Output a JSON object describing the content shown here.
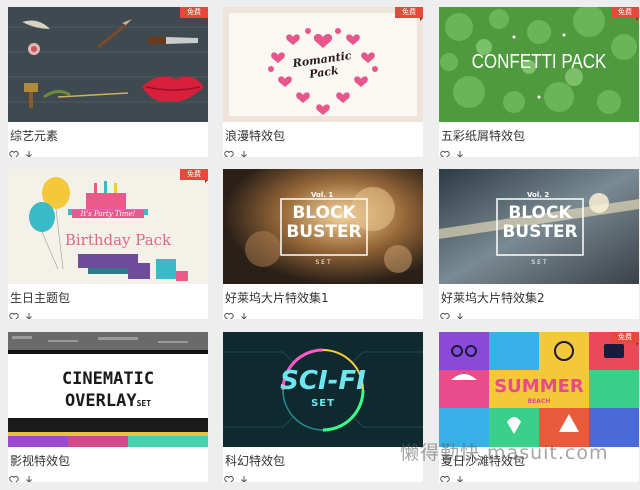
{
  "free_badge": "免费",
  "icons": {
    "favorite": "heart-icon",
    "download": "download-icon"
  },
  "cards": [
    {
      "title": "综艺元素",
      "free": true
    },
    {
      "title": "浪漫特效包",
      "free": true,
      "thumb_text": "Romantic Pack"
    },
    {
      "title": "五彩纸屑特效包",
      "free": true,
      "thumb_text": "CONFETTI PACK"
    },
    {
      "title": "生日主题包",
      "free": true,
      "thumb_text": "Birthday Pack",
      "thumb_sub": "It's Party Time!"
    },
    {
      "title": "好莱坞大片特效集1",
      "free": false,
      "thumb_vol": "Vol. 1",
      "thumb_line1": "BLOCK",
      "thumb_line2": "BUSTER",
      "thumb_set": "SET"
    },
    {
      "title": "好莱坞大片特效集2",
      "free": false,
      "thumb_vol": "Vol. 2",
      "thumb_line1": "BLOCK",
      "thumb_line2": "BUSTER",
      "thumb_set": "SET"
    },
    {
      "title": "影视特效包",
      "free": false,
      "thumb_line1": "CINEMATIC",
      "thumb_line2": "OVERLAY",
      "thumb_set": "SET"
    },
    {
      "title": "科幻特效包",
      "free": false,
      "thumb_line1": "SCI-FI",
      "thumb_set": "SET"
    },
    {
      "title": "夏日沙滩特效包",
      "free": true,
      "thumb_line1": "SUMMER",
      "thumb_sub": "BEACH"
    }
  ],
  "watermark": "懒得勤快 masuit.com",
  "colors": {
    "badge": "#e8473c",
    "title": "#333333",
    "page_bg": "#eeeeee"
  }
}
